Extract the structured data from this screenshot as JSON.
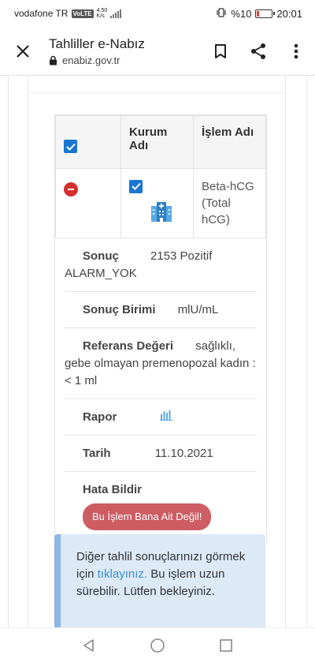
{
  "status_bar": {
    "carrier": "vodafone TR",
    "volte": "VoLTE",
    "net_speed": "4.50",
    "net_unit": "K/s",
    "battery": "%10",
    "time": "20:01"
  },
  "toolbar": {
    "title": "Tahliller e-Nabız",
    "url": "enabiz.gov.tr"
  },
  "table": {
    "headers": [
      "",
      "Kurum Adı",
      "İşlem Adı"
    ],
    "row": {
      "procedure": "Beta-hCG (Total hCG)"
    }
  },
  "details": {
    "result_label": "Sonuç",
    "result_value": "2153 Pozitif",
    "result_value_cont": "ALARM_YOK",
    "unit_label": "Sonuç Birimi",
    "unit_value": "mlU/mL",
    "ref_label": "Referans Değeri",
    "ref_value": "sağlıklı,",
    "ref_value_cont": "gebe olmayan premenopozal kadın :< 1 ml",
    "report_label": "Rapor",
    "date_label": "Tarih",
    "date_value": "11.10.2021",
    "error_label": "Hata Bildir",
    "error_button": "Bu İşlem Bana Ait Değil!"
  },
  "info": {
    "text_before": "Diğer tahlil sonuçlarınızı görmek için ",
    "link": "tıklayınız.",
    "text_after": " Bu işlem uzun sürebilir. Lütfen bekleyiniz."
  },
  "colors": {
    "checkbox_blue": "#1976d2",
    "remove_red": "#d32f2f",
    "error_button": "#cd5c63",
    "info_bg": "#dce9f7",
    "info_border": "#8eb7e3",
    "link_blue": "#3b8fd8"
  }
}
